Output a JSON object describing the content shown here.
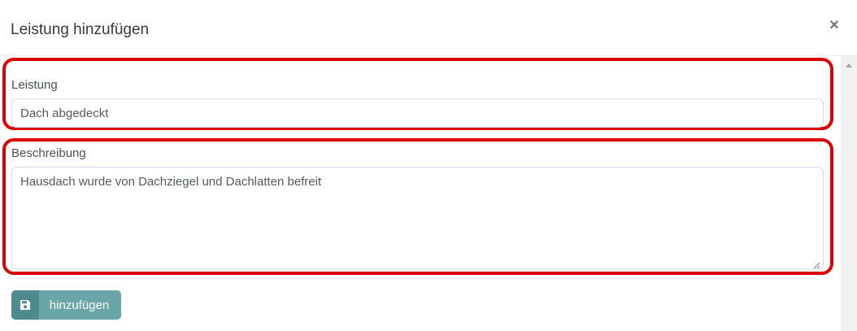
{
  "modal": {
    "title": "Leistung hinzufügen",
    "close_symbol": "×"
  },
  "form": {
    "leistung": {
      "label": "Leistung",
      "value": "Dach abgedeckt"
    },
    "beschreibung": {
      "label": "Beschreibung",
      "value": "Hausdach wurde von Dachziegel und Dachlatten befreit"
    }
  },
  "submit": {
    "label": "hinzufügen",
    "icon": "save-icon"
  },
  "colors": {
    "highlight": "#dd0000",
    "button_bg": "#6aa5a7",
    "button_icon_bg": "#4d8b8e"
  }
}
